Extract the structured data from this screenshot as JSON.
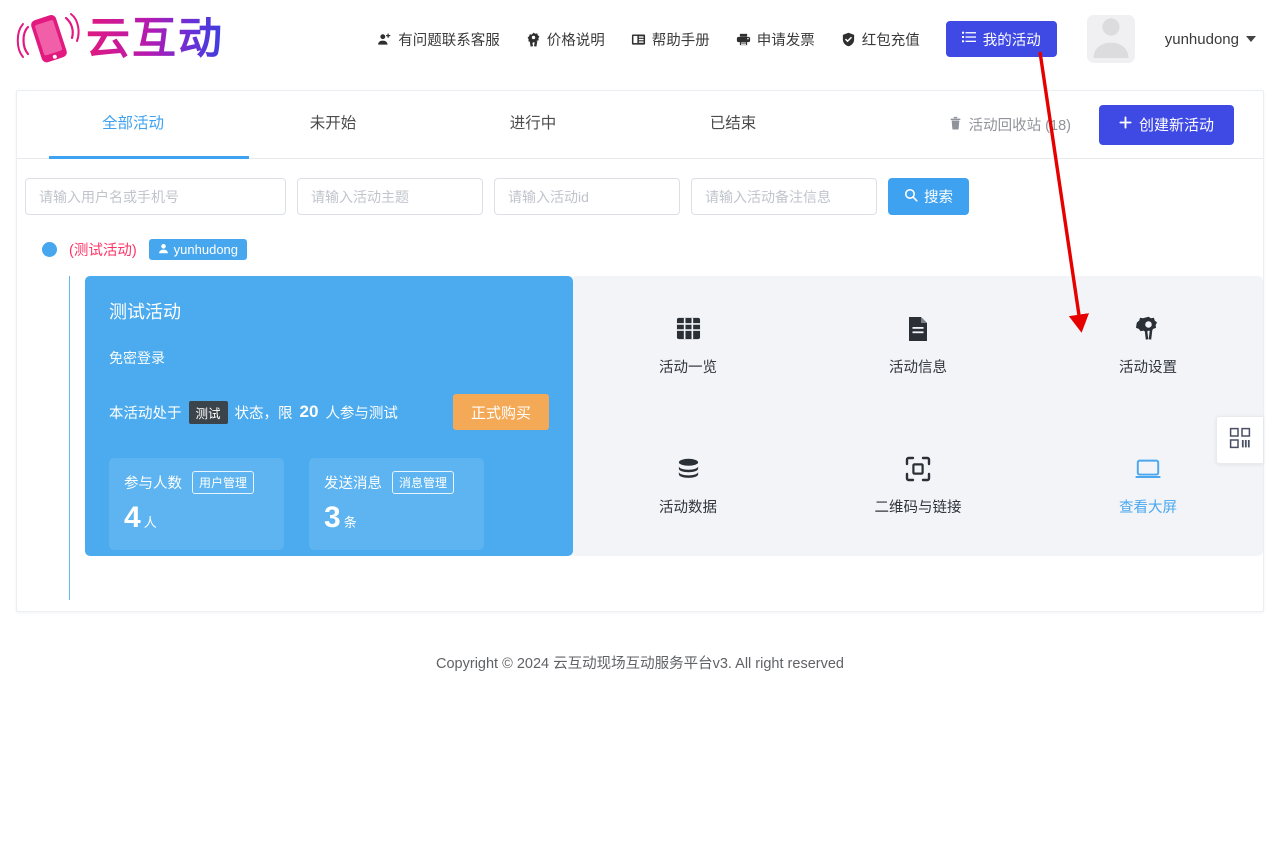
{
  "header": {
    "logo_text": "云互动",
    "logo_icon": "phone-motion-logo-icon",
    "nav": [
      {
        "label": "有问题联系客服",
        "icon": "user-add-icon"
      },
      {
        "label": "价格说明",
        "icon": "price-badge-icon"
      },
      {
        "label": "帮助手册",
        "icon": "book-icon"
      },
      {
        "label": "申请发票",
        "icon": "printer-icon"
      },
      {
        "label": "红包充值",
        "icon": "shield-check-icon"
      }
    ],
    "my_activity_button": "我的活动",
    "my_activity_icon": "list-icon",
    "username": "yunhudong",
    "avatar_icon": "user-avatar-placeholder"
  },
  "tabs": [
    {
      "label": "全部活动",
      "active": true
    },
    {
      "label": "未开始",
      "active": false
    },
    {
      "label": "进行中",
      "active": false
    },
    {
      "label": "已结束",
      "active": false
    }
  ],
  "toolbar": {
    "recycle_label": "活动回收站 (18)",
    "recycle_icon": "trash-icon",
    "create_label": "创建新活动",
    "create_icon": "plus-icon"
  },
  "search": {
    "placeholder_user": "请输入用户名或手机号",
    "placeholder_topic": "请输入活动主题",
    "placeholder_id": "请输入活动id",
    "placeholder_remark": "请输入活动备注信息",
    "button_label": "搜索",
    "button_icon": "search-icon",
    "value_user": "",
    "value_topic": "",
    "value_id": "",
    "value_remark": ""
  },
  "activity": {
    "flag_label": "(测试活动)",
    "owner_tag": "yunhudong",
    "owner_tag_icon": "user-icon",
    "title": "测试活动",
    "subtitle": "免密登录",
    "status_prefix": "本活动处于",
    "status_badge": "测试",
    "status_middle": "状态，限",
    "status_limit": "20",
    "status_suffix": "人参与测试",
    "buy_button": "正式购买",
    "stats": [
      {
        "label": "参与人数",
        "chip": "用户管理",
        "value": "4",
        "unit": "人"
      },
      {
        "label": "发送消息",
        "chip": "消息管理",
        "value": "3",
        "unit": "条"
      }
    ],
    "actions": [
      {
        "label": "活动一览",
        "icon": "grid-icon",
        "highlight": false
      },
      {
        "label": "活动信息",
        "icon": "document-icon",
        "highlight": false
      },
      {
        "label": "活动设置",
        "icon": "gear-icon",
        "highlight": false
      },
      {
        "label": "活动数据",
        "icon": "database-icon",
        "highlight": false
      },
      {
        "label": "二维码与链接",
        "icon": "qrcode-scan-icon",
        "highlight": false
      },
      {
        "label": "查看大屏",
        "icon": "monitor-icon",
        "highlight": true
      }
    ]
  },
  "side_float": {
    "icon": "qrcode-icon"
  },
  "footer": {
    "text": "Copyright © 2024 云互动现场互动服务平台v3. All right reserved"
  },
  "annotation": {
    "color": "#e60000",
    "points": "from my-activity-button to activity-settings-icon"
  }
}
